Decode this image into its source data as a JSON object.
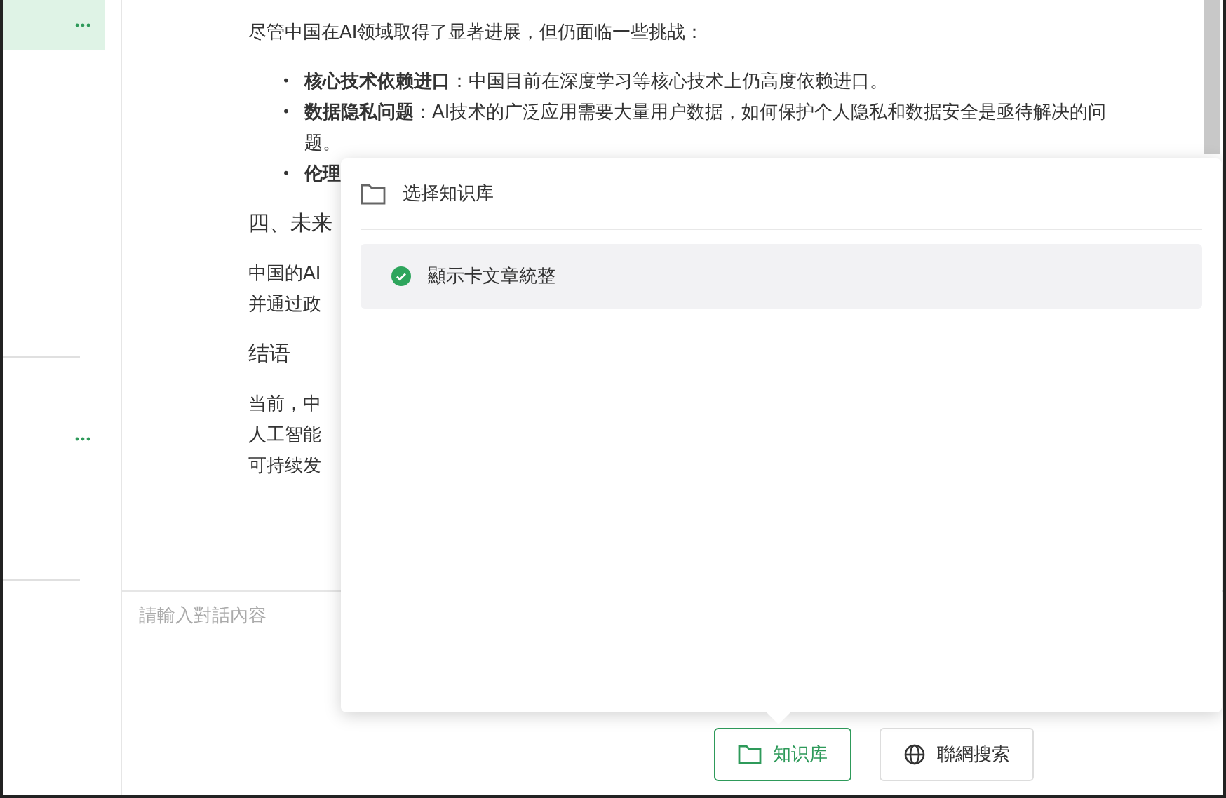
{
  "sidebar": {
    "items": [
      {
        "selected": true
      },
      {
        "selected": false
      }
    ]
  },
  "article": {
    "intro": "尽管中国在AI领域取得了显著进展，但仍面临一些挑战：",
    "bullets": [
      {
        "marker": "•",
        "text": "**核心技术依赖进口**：中国目前在深度学习等核心技术上仍高度依赖进口。"
      },
      {
        "marker": "•",
        "text": "**数据隐私问题**：AI技术的广泛应用需要大量用户数据，如何保护个人隐私和数据安全是亟待解决的问题。"
      },
      {
        "marker": "•",
        "text": "**伦理**"
      }
    ],
    "sections": [
      {
        "heading": "四、未来",
        "lines": [
          "中国的AI",
          "并通过政"
        ]
      },
      {
        "heading": "结语",
        "lines": [
          "当前，中",
          "人工智能",
          "可持续发"
        ]
      }
    ]
  },
  "popup": {
    "title": "选择知识库",
    "items": [
      {
        "label": "顯示卡文章統整",
        "checked": true
      }
    ]
  },
  "input": {
    "placeholder": "請輸入對話內容"
  },
  "buttons": [
    {
      "label": "知识库",
      "kind": "folder",
      "selected": true
    },
    {
      "label": "聯網搜索",
      "kind": "globe",
      "selected": false
    }
  ]
}
